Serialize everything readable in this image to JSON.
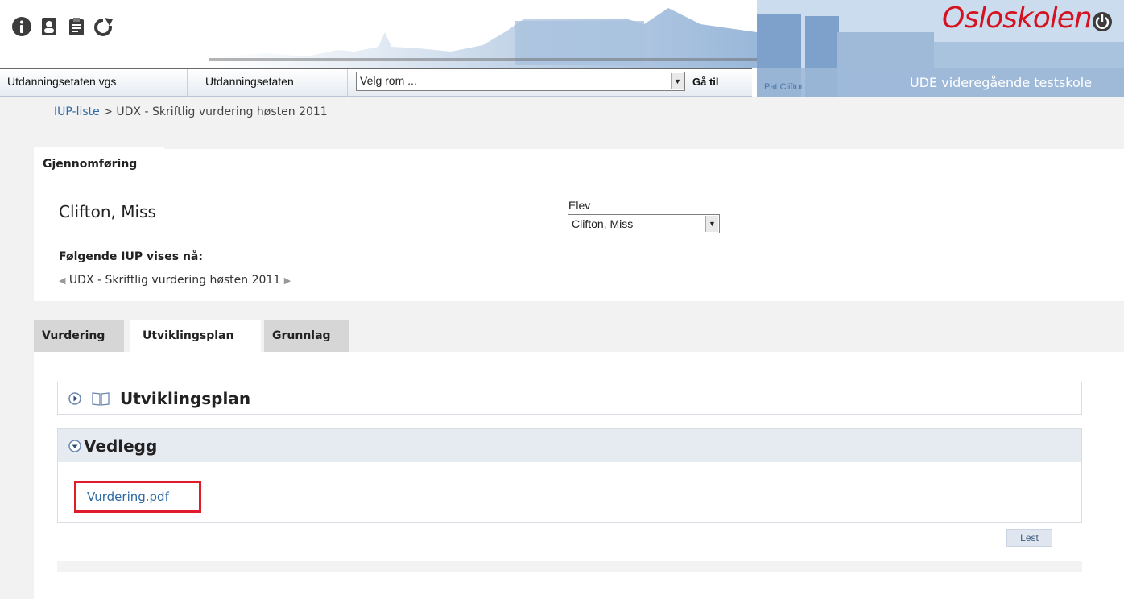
{
  "header": {
    "brand": "Osloskolen",
    "school_name": "UDE videregående testskole",
    "user_name": "Pat Clifton",
    "top_icons": [
      "info-icon",
      "contacts-icon",
      "clipboard-icon",
      "refresh-icon"
    ],
    "power_icon": "power-icon",
    "brand_color": "#d5121f"
  },
  "navbar": {
    "links": [
      "Utdanningsetaten vgs",
      "Utdanningsetaten"
    ],
    "room_select_value": "Velg rom ...",
    "goto_label": "Gå til"
  },
  "breadcrumb": {
    "link": "IUP-liste",
    "separator": ">",
    "current": "UDX - Skriftlig vurdering høsten 2011"
  },
  "main_tab": "Gjennomføring",
  "student": {
    "name": "Clifton, Miss",
    "elev_label": "Elev",
    "elev_select_value": "Clifton, Miss"
  },
  "iup": {
    "heading": "Følgende IUP vises nå:",
    "current": "UDX - Skriftlig vurdering høsten 2011"
  },
  "sub_tabs": [
    "Vurdering",
    "Utviklingsplan",
    "Grunnlag"
  ],
  "active_sub_tab": "Utviklingsplan",
  "sections": {
    "utviklingsplan_title": "Utviklingsplan",
    "vedlegg_title": "Vedlegg",
    "attachments": [
      "Vurdering.pdf"
    ]
  },
  "lest_button": "Lest",
  "colors": {
    "link": "#2d6aa4",
    "highlight": "#e21b2b",
    "tab_inactive": "#d6d6d6",
    "section_header": "#e6eaf1"
  }
}
